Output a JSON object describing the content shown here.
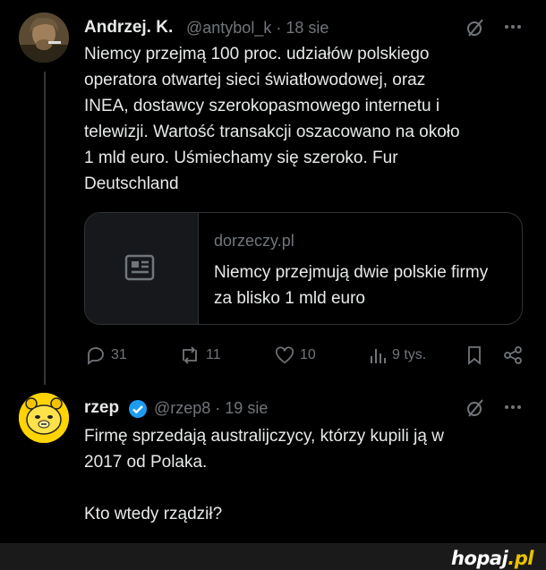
{
  "tweet1": {
    "name": "Andrzej. K.",
    "handle_line": "@antybol_k · 18 sie",
    "text": "Niemcy przejmą 100 proc. udziałów polskiego\noperatora otwartej sieci światłowodowej, oraz\nINEA, dostawcy szerokopasmowego internetu i\ntelewizji. Wartość transakcji oszacowano na około\n1 mld euro. Uśmiechamy się szeroko. Fur\nDeutschland",
    "card": {
      "domain": "dorzeczy.pl",
      "title": "Niemcy przejmują dwie polskie firmy za blisko 1 mld euro"
    },
    "actions": {
      "replies": "31",
      "reposts": "11",
      "likes": "10",
      "views": "9 tys."
    }
  },
  "tweet2": {
    "name": "rzep",
    "handle_line": "@rzep8 · 19 sie",
    "text": "Firmę sprzedają australijczycy, którzy kupili ją w\n2017 od Polaka.\n\nKto wtedy rządził?"
  },
  "watermark": {
    "name": "hopaj",
    "dot": ".pl"
  },
  "colors": {
    "background": "#000000",
    "text": "#e7e9ea",
    "muted": "#71767b",
    "verified": "#1d9bf0"
  }
}
